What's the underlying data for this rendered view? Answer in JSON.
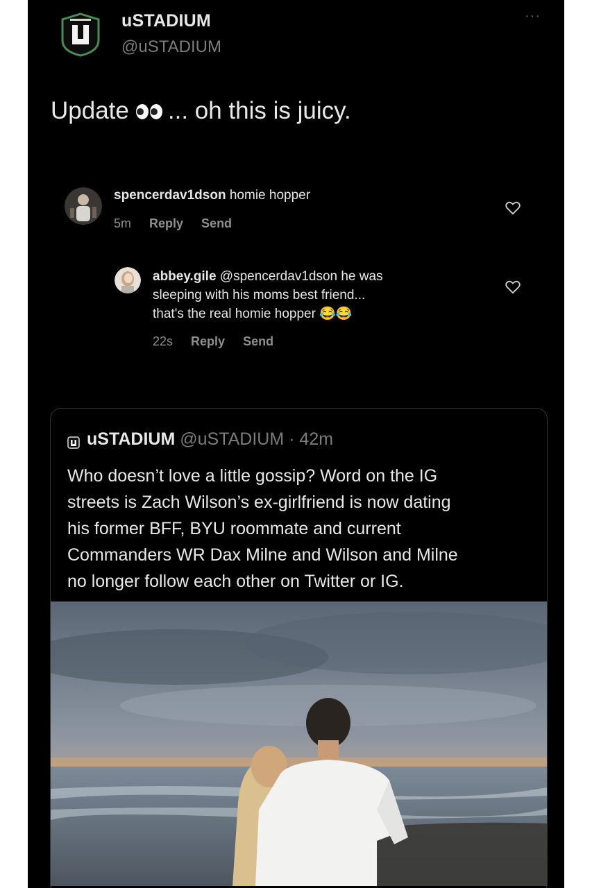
{
  "tweet": {
    "author_name": "uSTADIUM",
    "author_handle": "@uSTADIUM",
    "more": "···",
    "text_before": "Update",
    "text_after": "... oh this is juicy."
  },
  "comments": [
    {
      "username": "spencerdav1dson",
      "text": "homie hopper",
      "time": "5m",
      "reply": "Reply",
      "send": "Send"
    },
    {
      "username": "abbey.gile",
      "line1": "@spencerdav1dson he was",
      "line2": "sleeping with his moms best friend...",
      "line3": "that's the real homie hopper",
      "emoji": "😂😂",
      "time": "22s",
      "reply": "Reply",
      "send": "Send"
    }
  ],
  "quote": {
    "name": "uSTADIUM",
    "handle": "@uSTADIUM",
    "time": "· 42m",
    "lines": [
      "Who doesn’t love a little gossip? Word on the IG",
      "streets is Zach Wilson’s ex-girlfriend is now dating",
      "his former BFF, BYU roommate and current",
      "Commanders WR Dax Milne and Wilson and Milne",
      "no longer follow each other on Twitter or IG."
    ]
  },
  "colors": {
    "background": "#000000",
    "text": "#e8e8e8",
    "muted": "#7c7c7c",
    "accent": "#3a7d44"
  },
  "icons": {
    "avatar": "ustadium-logo-icon",
    "like": "heart-icon",
    "menu": "more-icon"
  }
}
